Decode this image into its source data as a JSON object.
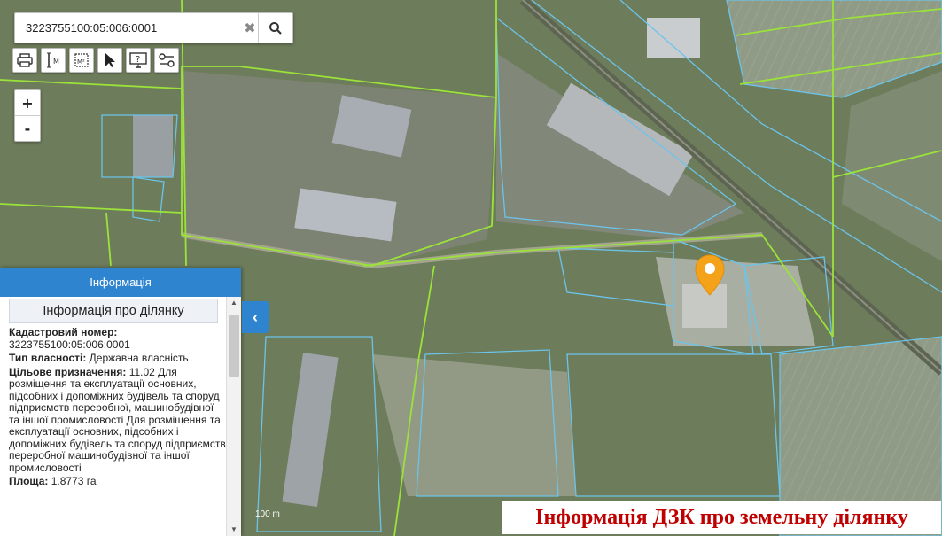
{
  "search": {
    "value": "3223755100:05:006:0001"
  },
  "icons": {
    "search": "search-icon",
    "clear": "clear-icon",
    "print": "printer-icon",
    "measure_length": "ruler-icon",
    "measure_area": "area-icon",
    "select": "pointer-icon",
    "identify": "identify-icon",
    "layers": "layers-icon",
    "marker": "map-marker-icon"
  },
  "zoom": {
    "in": "+",
    "out": "-"
  },
  "panel": {
    "header": "Інформація",
    "subheader": "Інформація про ділянку",
    "cadastral_label": "Кадастровий номер:",
    "cadastral_value": "3223755100:05:006:0001",
    "ownership_label": "Тип власності:",
    "ownership_value": "Державна власність",
    "purpose_label": "Цільове призначення:",
    "purpose_value": "11.02 Для розміщення та експлуатації основних, підсобних і допоміжних будівель та споруд підприємств переробної, машинобудівної та іншої промисловості Для розміщення та експлуатації основних, підсобних і допоміжних будівель та споруд підприємств переробної машинобудівної та іншої промисловості",
    "area_label": "Площа:",
    "area_value": "1.8773 га"
  },
  "scale_label": "100 m",
  "caption": "Інформація ДЗК про земельну ділянку",
  "colors": {
    "panel_header": "#2f84cf",
    "parcel_green": "#9be23a",
    "parcel_blue": "#6cc4ea",
    "marker": "#f5a21b",
    "caption_text": "#c00000"
  }
}
